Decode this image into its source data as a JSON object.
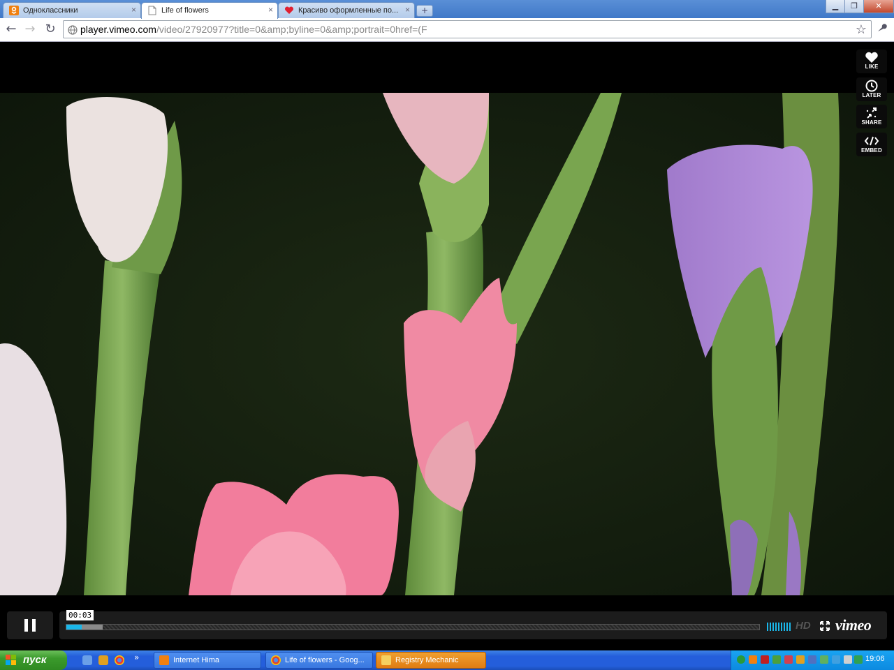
{
  "browser": {
    "tabs": [
      {
        "label": "Одноклассники",
        "active": false
      },
      {
        "label": "Life of flowers",
        "active": true
      },
      {
        "label": "Красиво оформленные по...",
        "active": false
      }
    ],
    "close_glyph": "×",
    "new_tab_glyph": "+",
    "window_buttons": {
      "minimize": "▁",
      "maximize": "❐",
      "close": "✕"
    },
    "nav": {
      "back": "←",
      "forward": "→",
      "reload": "↻"
    },
    "url_host": "player.vimeo.com",
    "url_path": "/video/27920977?title=0&amp;byline=0&amp;portrait=0href=(F",
    "star_glyph": "☆",
    "wrench_glyph": "🔧"
  },
  "player": {
    "side_buttons": [
      {
        "label": "LIKE",
        "icon": "heart-icon"
      },
      {
        "label": "LATER",
        "icon": "clock-icon"
      },
      {
        "label": "SHARE",
        "icon": "share-icon"
      },
      {
        "label": "EMBED",
        "icon": "embed-icon"
      }
    ],
    "time_display": "00:03",
    "progress_played": 0.022,
    "progress_buffered": 0.052,
    "hd_label": "HD",
    "logo": "vimeo",
    "accent_color": "#1ab7ea"
  },
  "taskbar": {
    "start_label": "пуск",
    "tasks": [
      {
        "label": "Internet Hima",
        "icon_color": "#f08010",
        "active": false
      },
      {
        "label": "Life of flowers - Goog...",
        "icon_color": "#dd4433",
        "active": false
      },
      {
        "label": "Registry Mechanic",
        "icon_color": "#d88a00",
        "active": true
      }
    ],
    "overflow_glyph": "»",
    "clock": "19:06"
  }
}
